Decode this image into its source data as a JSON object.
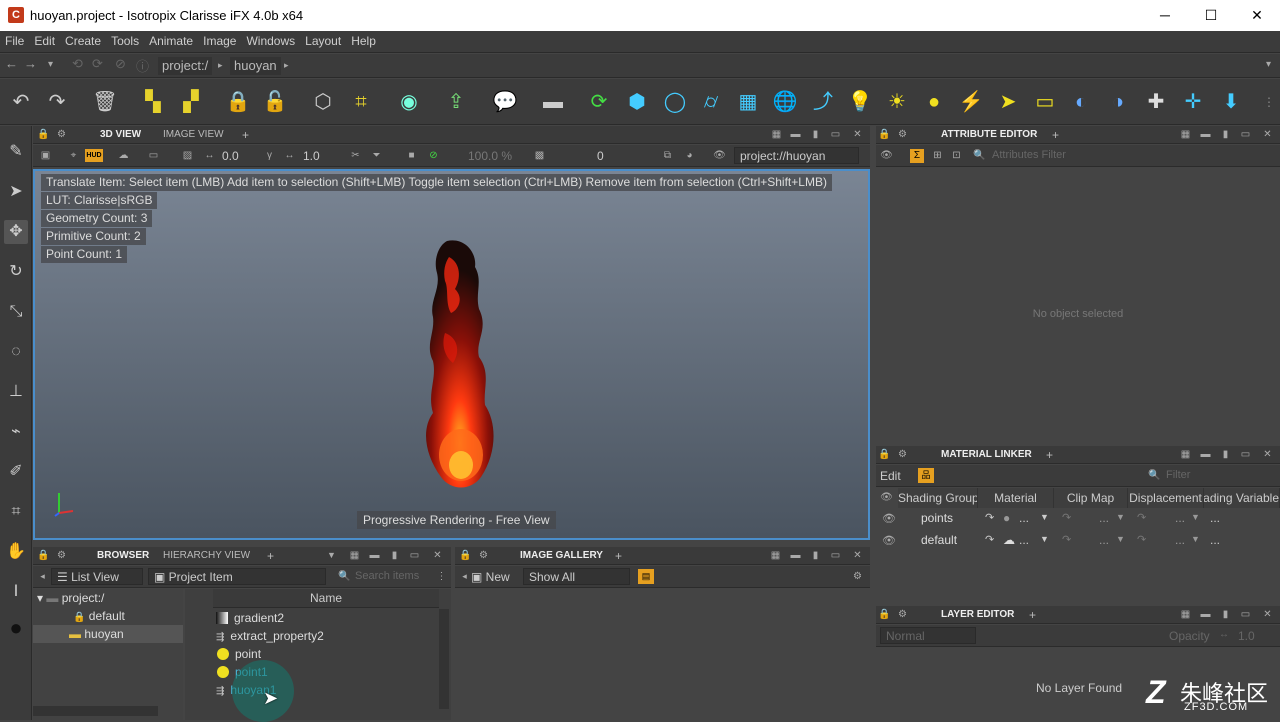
{
  "window": {
    "title": "huoyan.project - Isotropix Clarisse iFX 4.0b x64",
    "minimize": "─",
    "maximize": "☐",
    "close": "✕"
  },
  "menu": [
    "File",
    "Edit",
    "Create",
    "Tools",
    "Animate",
    "Image",
    "Windows",
    "Layout",
    "Help"
  ],
  "address": {
    "crumbs": [
      "project:/",
      "huoyan"
    ]
  },
  "viewport_panel": {
    "tabs": [
      "3D VIEW",
      "IMAGE VIEW"
    ],
    "add": "+",
    "hud_label": "HUD",
    "value1": "0.0",
    "value2": "1.0",
    "zoom": "100.0 %",
    "frame": "0",
    "path": "project://huoyan"
  },
  "viewport": {
    "hint": "Translate Item: Select item (LMB)  Add item to selection (Shift+LMB)  Toggle item selection (Ctrl+LMB)  Remove item from selection (Ctrl+Shift+LMB)",
    "lut": "LUT: Clarisse|sRGB",
    "geometry_count": "Geometry Count: 3",
    "primitive_count": "Primitive Count: 2",
    "point_count": "Point Count: 1",
    "status": "Progressive Rendering - Free View"
  },
  "attribute_editor": {
    "title": "ATTRIBUTE EDITOR",
    "add": "+",
    "filter_placeholder": "Attributes Filter",
    "empty": "No object selected"
  },
  "material_linker": {
    "title": "MATERIAL LINKER",
    "add": "+",
    "edit": "Edit",
    "filter_placeholder": "Filter",
    "columns": [
      "Shading Group",
      "Material",
      "Clip Map",
      "Displacement",
      "Shading Variable"
    ],
    "rows": [
      {
        "name": "points",
        "material": "..."
      },
      {
        "name": "default",
        "material": "..."
      }
    ],
    "ellipsis": "..."
  },
  "layer_editor": {
    "title": "LAYER EDITOR",
    "add": "+",
    "blend_mode": "Normal",
    "opacity_label": "Opacity",
    "opacity_value": "1.0",
    "empty": "No Layer Found"
  },
  "browser": {
    "tabs": [
      "BROWSER",
      "HIERARCHY VIEW"
    ],
    "add": "+",
    "view_mode": "List View",
    "filter_type": "Project Item",
    "search_placeholder": "Search items",
    "tree": [
      "project:/",
      "default",
      "huoyan"
    ],
    "column_name": "Name",
    "items": [
      "gradient2",
      "extract_property2",
      "point",
      "point1",
      "huoyan1"
    ]
  },
  "image_gallery": {
    "title": "IMAGE GALLERY",
    "add": "+",
    "new": "New",
    "show": "Show All"
  },
  "watermark": {
    "brand": "朱峰社区",
    "url": "ZF3D.COM"
  },
  "colors": {
    "accent": "#4a8ecb",
    "yellow": "#f0e020",
    "selected_text": "#4ab8d8"
  }
}
